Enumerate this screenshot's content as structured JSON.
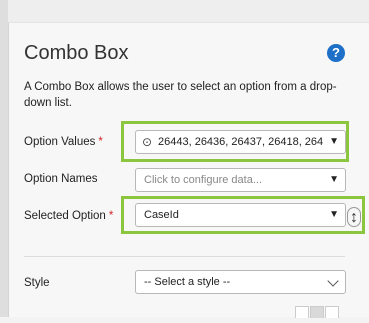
{
  "panel": {
    "title": "Combo Box",
    "help_icon": "question-icon",
    "help_glyph": "?",
    "description": "A Combo Box allows the user to select an option from a drop-down list."
  },
  "fields": {
    "option_values": {
      "label": "Option Values",
      "required": "*",
      "value": "26443, 26436, 26437, 26418, 264",
      "icon": "target-icon",
      "icon_glyph": "⊙"
    },
    "option_names": {
      "label": "Option Names",
      "placeholder": "Click to configure data..."
    },
    "selected_option": {
      "label": "Selected Option",
      "required": "*",
      "value": "CaseId",
      "resize_glyph": "↕"
    },
    "style": {
      "label": "Style",
      "value": "-- Select a style --"
    }
  },
  "colors": {
    "highlight": "#8cc63f",
    "required": "#d2232a",
    "help": "#1d6fc8"
  }
}
